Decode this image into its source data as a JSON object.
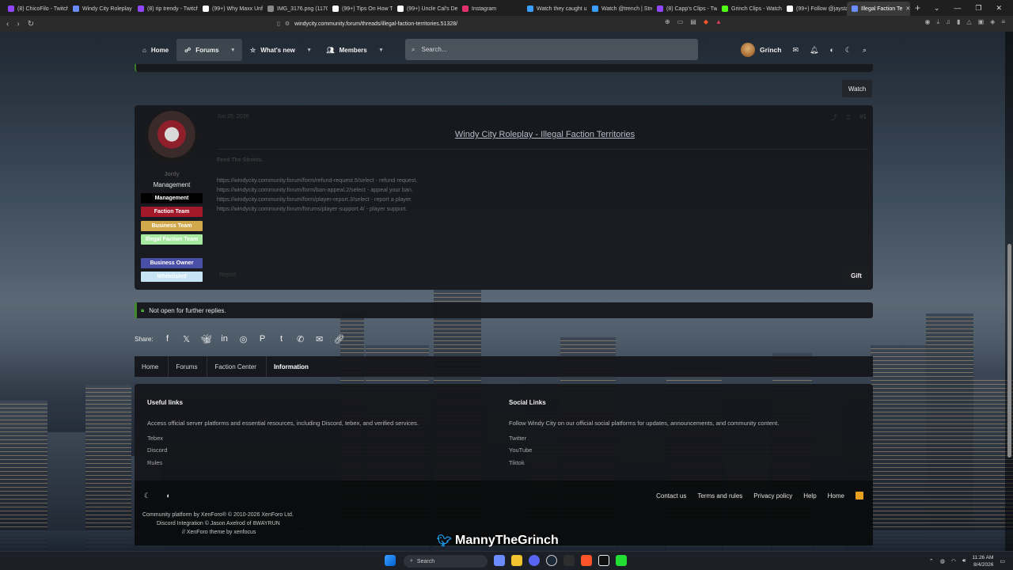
{
  "browser": {
    "tabs": [
      {
        "title": "(8) ChicoFilo - Twitch",
        "color": "#9146ff"
      },
      {
        "title": "Windy City Roleplay",
        "color": "#6c8cff"
      },
      {
        "title": "(8) rip trendy - Twitch",
        "color": "#9146ff"
      },
      {
        "title": "(99+) Why Maxx Unfo",
        "color": "#ffffff"
      },
      {
        "title": "IMG_3176.png (1170",
        "color": "#8a8a8a"
      },
      {
        "title": "(99+) Tips On How To",
        "color": "#ffffff"
      },
      {
        "title": "(99+) Uncle Cal's Dea",
        "color": "#ffffff"
      },
      {
        "title": "Instagram",
        "color": "#e1306c"
      },
      {
        "title": "Watch they caught u",
        "color": "#3aa0ff"
      },
      {
        "title": "Watch @trench | Stre",
        "color": "#3aa0ff"
      },
      {
        "title": "(8) Capp's Clips - Twi",
        "color": "#9146ff"
      },
      {
        "title": "Grinch Clips - Watch",
        "color": "#53fc18"
      },
      {
        "title": "(99+) Follow @jaystar",
        "color": "#ffffff"
      },
      {
        "title": "Illegal Faction Te",
        "color": "#6c8cff",
        "active": true
      }
    ],
    "new_tab": "+",
    "url": "windycity.community.forum/threads/illegal-faction-territories.51328/"
  },
  "nav": {
    "home": "Home",
    "forums": "Forums",
    "whats_new": "What's new",
    "members": "Members",
    "search_placeholder": "Search...",
    "username": "Grinch"
  },
  "watch_label": "Watch",
  "post": {
    "author": "Jordy",
    "author_title": "Management",
    "badges": [
      {
        "label": "Management",
        "bg": "#000000",
        "fg": "#ffffff"
      },
      {
        "label": "Faction Team",
        "bg": "#a3182a",
        "fg": "#ffffff"
      },
      {
        "label": "Business Team",
        "bg": "#d1a84b",
        "fg": "#ffffff"
      },
      {
        "label": "Illegal Faction Team",
        "bg": "#a7e8a0",
        "fg": "#ffffff"
      },
      {
        "label": "Business Owner",
        "bg": "#4a4fa6",
        "fg": "#ffffff"
      },
      {
        "label": "Whitelisted",
        "bg": "#c7e4f4",
        "fg": "#ffffff"
      }
    ],
    "date": "Jun 25, 2026",
    "number": "#1",
    "title": "Windy City Roleplay - Illegal Faction Territories",
    "feed": "Feed The Streets.",
    "links": [
      "https://windycity.community.forum/form/refund-request.5/select - refund request.",
      "https://windycity.community.forum/form/ban-appeal.2/select - appeal your ban.",
      "https://windycity.community.forum/form/player-report.3/select - report a player.",
      "https://windycity.community.forum/forums/player-support.4/ - player support."
    ],
    "report": "Report",
    "gift": "Gift"
  },
  "notice": "Not open for further replies.",
  "share": {
    "label": "Share:",
    "icons": [
      "facebook-icon",
      "x-icon",
      "bluesky-icon",
      "linkedin-icon",
      "reddit-icon",
      "pinterest-icon",
      "tumblr-icon",
      "whatsapp-icon",
      "email-icon",
      "link-icon"
    ]
  },
  "breadcrumbs": [
    "Home",
    "Forums",
    "Faction Center",
    "Information"
  ],
  "footer": {
    "useful": {
      "heading": "Useful links",
      "desc": "Access official server platforms and essential resources, including Discord, tebex, and verified services.",
      "links": [
        "Tebex",
        "Discord",
        "Rules"
      ]
    },
    "social": {
      "heading": "Social Links",
      "desc": "Follow Windy City on our official social platforms for updates, announcements, and community content.",
      "links": [
        "Twitter",
        "YouTube",
        "Tiktok"
      ]
    },
    "bottom_links": [
      "Contact us",
      "Terms and rules",
      "Privacy policy",
      "Help",
      "Home"
    ],
    "copyright_1": "Community platform by XenForo® © 2010-2026 XenForo Ltd.",
    "copyright_2": "Discord Integration © Jason Axelrod of 8WAYRUN",
    "copyright_3": "// XenForo theme by xenfocus"
  },
  "overlay_handle": "MannyTheGrinch",
  "taskbar": {
    "search": "Search",
    "time": "11:26 AM",
    "date": "8/4/2026"
  }
}
